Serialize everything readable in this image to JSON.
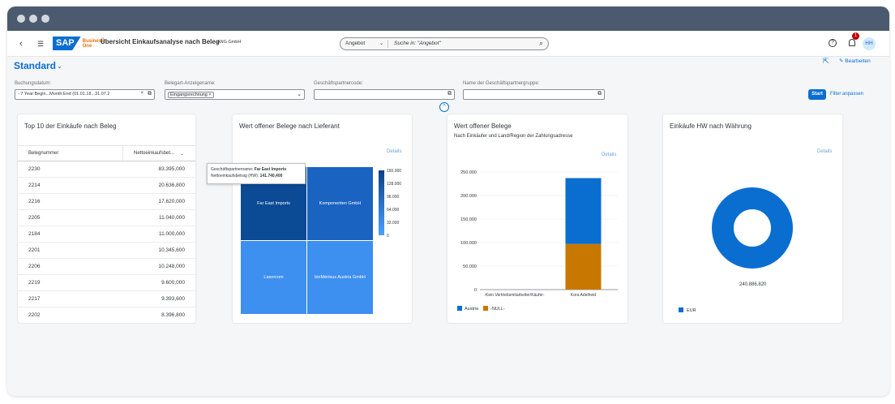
{
  "shell": {
    "logo": "SAP",
    "logo_sub": "Business One",
    "app_title": "Übersicht Einkaufsanalyse nach Beleg",
    "company": "ANG GmbH",
    "search_scope": "Angebot",
    "search_placeholder": "Suche in: \"Angebot\"",
    "notification_count": "1",
    "user_initials": "HH"
  },
  "page": {
    "variant": "Standard",
    "edit_label": "Bearbeiten"
  },
  "filters": {
    "buchungsdatum": {
      "label": "Buchungsdatum:",
      "value": "- 7 Year:Begin...Month:End (01.01.18...31.07.2"
    },
    "belegart": {
      "label": "Belegart-Anzeigename:",
      "token": "Eingangsrechnung"
    },
    "partnercode": {
      "label": "Geschäftspartnercode:",
      "value": ""
    },
    "partnergruppe": {
      "label": "Name der Geschäftspartnergruppe:",
      "value": ""
    },
    "start_label": "Start",
    "adapt_label": "Filter anpassen"
  },
  "cards": {
    "top10": {
      "title": "Top 10 der Einkäufe nach Beleg",
      "col1": "Belegnummer",
      "col2": "Nettoeinkaufsbet...",
      "rows": [
        {
          "beleg": "2230",
          "betrag": "83.395,000"
        },
        {
          "beleg": "2214",
          "betrag": "20.636,800"
        },
        {
          "beleg": "2216",
          "betrag": "17.620,000"
        },
        {
          "beleg": "2205",
          "betrag": "11.040,000"
        },
        {
          "beleg": "2184",
          "betrag": "11.000,000"
        },
        {
          "beleg": "2201",
          "betrag": "10.345,600"
        },
        {
          "beleg": "2206",
          "betrag": "10.248,000"
        },
        {
          "beleg": "2219",
          "betrag": "9.600,000"
        },
        {
          "beleg": "2217",
          "betrag": "9.393,600"
        },
        {
          "beleg": "2202",
          "betrag": "8.396,800"
        }
      ]
    },
    "treemap": {
      "title": "Wert offener Belege nach Lieferant",
      "details": "Details",
      "tooltip_line1_label": "Geschäftspartnername:",
      "tooltip_line1_value": "Far East Imports",
      "tooltip_line2_label": "Nettoeinkaufsbetrag (HW):",
      "tooltip_line2_value": "141.740,400",
      "colors": {
        "dark": "#0b4a95",
        "mid": "#1b63c0",
        "light": "#3d8ff0"
      }
    },
    "bar": {
      "title": "Wert offener Belege",
      "subtitle": "Nach Einkäufer und Land/Region der Zahlungsadresse",
      "details": "Details"
    },
    "donut": {
      "title": "Einkäufe HW nach Währung",
      "details": "Details",
      "value_label": "240.886,820"
    }
  },
  "chart_data": [
    {
      "type": "heatmap",
      "title": "Wert offener Belege nach Lieferant",
      "cells": [
        {
          "label": "Far East Imports",
          "value": 141740.4
        },
        {
          "label": "Komponenten GmbH",
          "value": 120000
        },
        {
          "label": "Lasercom",
          "value": 30000
        },
        {
          "label": "bioMérieux Austria GmbH",
          "value": 28000
        }
      ],
      "color_scale_ticks": [
        "160.000",
        "128.000",
        "96.000",
        "64.000",
        "32.000",
        "0"
      ]
    },
    {
      "type": "bar",
      "title": "Wert offener Belege",
      "categories": [
        "-Kein Vertriebsmitarbeiter/Käufer-",
        "Kora Adelheid"
      ],
      "series": [
        {
          "name": "Austria",
          "color": "#0a6ed1",
          "values": [
            0,
            140000
          ]
        },
        {
          "name": "-NULL-",
          "color": "#c87800",
          "values": [
            0,
            97000
          ]
        }
      ],
      "ylim": [
        0,
        250000
      ],
      "y_ticks": [
        {
          "value": 250000,
          "label": "250.000"
        },
        {
          "value": 200000,
          "label": "200.000"
        },
        {
          "value": 150000,
          "label": "150.000"
        },
        {
          "value": 100000,
          "label": "100.000"
        },
        {
          "value": 50000,
          "label": "50.000"
        },
        {
          "value": 0,
          "label": "0"
        }
      ],
      "stacked": true,
      "legend": "bottom-left"
    },
    {
      "type": "pie",
      "title": "Einkäufe HW nach Währung",
      "donut": true,
      "slices": [
        {
          "name": "EUR",
          "value": 240886.82,
          "color": "#0a6ed1"
        }
      ],
      "legend": "bottom-left"
    }
  ]
}
